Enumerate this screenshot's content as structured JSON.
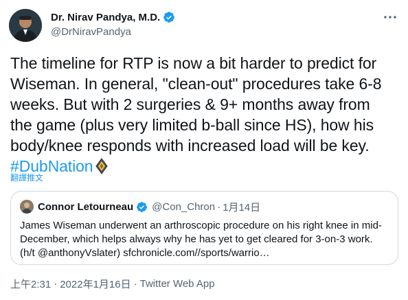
{
  "author": {
    "display_name": "Dr. Nirav Pandya, M.D.",
    "handle": "@DrNiravPandya",
    "verified": true
  },
  "tweet": {
    "lines": [
      "The timeline for RTP is now a bit harder to predict for",
      "Wiseman.  In general, \"clean-out\" procedures take 6-8",
      "weeks.  But with 2 surgeries & 9+ months away from",
      "the game (plus very limited b-ball since HS), how his",
      "body/knee responds with increased load will be key."
    ],
    "hashtag": "#DubNation",
    "emoji": "dubnation-emoji"
  },
  "translate_label": "翻譯推文",
  "quote": {
    "display_name": "Connor Letourneau",
    "handle": "@Con_Chron",
    "dot": "·",
    "date": "1月14日",
    "lines": [
      "James Wiseman underwent an arthroscopic procedure on his right knee in mid-",
      "December, which helps always why he has yet to get cleared for 3-on-3 work.",
      "(h/t @anthonyVslater) sfchronicle.com//sports/warrio…"
    ]
  },
  "footer": {
    "time": "上午2:31",
    "sep1": "·",
    "date": "2022年1月16日",
    "sep2": "·",
    "source": "Twitter Web App"
  },
  "colors": {
    "text": "#0f1419",
    "secondary": "#536471",
    "link": "#1d9bf0",
    "border": "#cfd9de"
  }
}
